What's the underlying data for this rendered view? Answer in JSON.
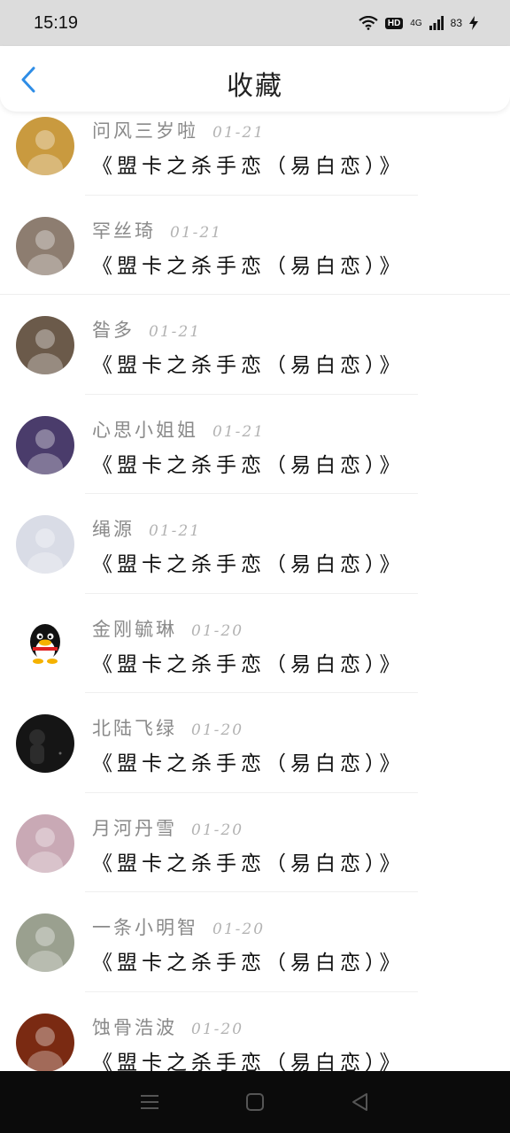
{
  "status_bar": {
    "time": "15:19",
    "hd_badge": "HD",
    "network": "4G",
    "battery": "83"
  },
  "header": {
    "title": "收藏",
    "back_icon": "chevron-left-icon",
    "accent": "#2e8de6"
  },
  "items": [
    {
      "name": "问风三岁啦",
      "date": "01-21",
      "title": "《盟卡之杀手恋（易白恋）》",
      "avatar_color": "#c99a3f"
    },
    {
      "name": "罕丝琦",
      "date": "01-21",
      "title": "《盟卡之杀手恋（易白恋）》",
      "avatar_color": "#8d7d70"
    },
    {
      "name": "昝多",
      "date": "01-21",
      "title": "《盟卡之杀手恋（易白恋）》",
      "avatar_color": "#6b5a4a"
    },
    {
      "name": "心思小姐姐",
      "date": "01-21",
      "title": "《盟卡之杀手恋（易白恋）》",
      "avatar_color": "#4a3c6b"
    },
    {
      "name": "绳源",
      "date": "01-21",
      "title": "《盟卡之杀手恋（易白恋）》",
      "avatar_color": "#d9dce6"
    },
    {
      "name": "金刚毓琳",
      "date": "01-20",
      "title": "《盟卡之杀手恋（易白恋）》",
      "avatar_color": "#ffffff"
    },
    {
      "name": "北陆飞绿",
      "date": "01-20",
      "title": "《盟卡之杀手恋（易白恋）》",
      "avatar_color": "#151515"
    },
    {
      "name": "月河丹雪",
      "date": "01-20",
      "title": "《盟卡之杀手恋（易白恋）》",
      "avatar_color": "#c9a9b5"
    },
    {
      "name": "一条小明智",
      "date": "01-20",
      "title": "《盟卡之杀手恋（易白恋）》",
      "avatar_color": "#9aa08f"
    },
    {
      "name": "蚀骨浩波",
      "date": "01-20",
      "title": "《盟卡之杀手恋（易白恋）》",
      "avatar_color": "#7a2a12"
    }
  ],
  "nav_bar": {
    "menu_icon": "menu-icon",
    "home_icon": "home-square-icon",
    "back_icon": "back-triangle-icon"
  }
}
